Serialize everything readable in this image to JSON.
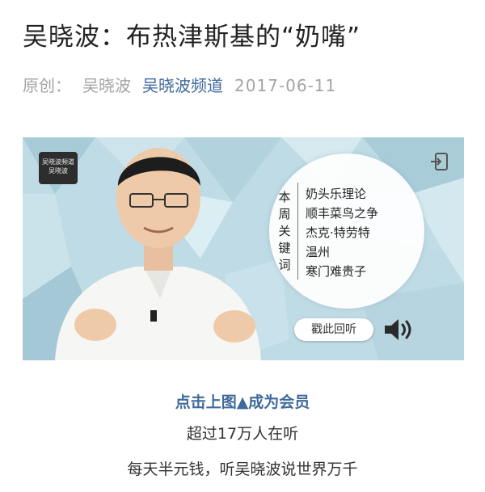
{
  "article": {
    "title": "吴晓波：布热津斯基的“奶嘴”",
    "original_label": "原创：",
    "author": "吴晓波",
    "channel": "吴晓波频道",
    "date": "2017-06-11"
  },
  "banner": {
    "logo_lines": [
      "吴晓波频道",
      "吴晓波"
    ],
    "keywords_title": "本周关键词",
    "keywords": [
      "奶头乐理论",
      "顺丰菜鸟之争",
      "杰克·特劳特",
      "温州",
      "寒门难贵子"
    ],
    "replay_label": "戳此回听",
    "icons": [
      "exit-icon",
      "speaker-icon"
    ]
  },
  "cta": {
    "link_text": "点击上图▲成为会员",
    "line1": "超过17万人在听",
    "line2": "每天半元钱，听吴晓波说世界万千"
  },
  "colors": {
    "link": "#3f6a9b",
    "banner_bg": "#bcd9e3"
  }
}
